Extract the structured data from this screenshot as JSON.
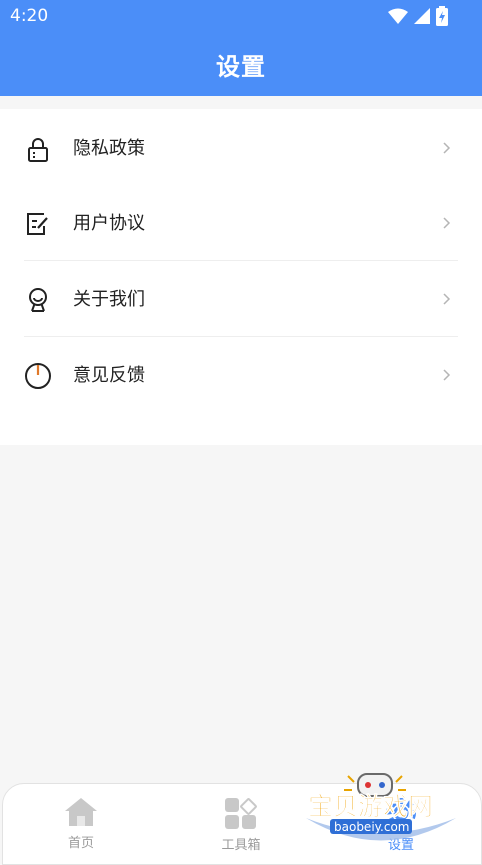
{
  "status_bar": {
    "time": "4:20"
  },
  "header": {
    "title": "设置"
  },
  "menu": {
    "items": [
      {
        "label": "隐私政策",
        "icon": "lock-icon"
      },
      {
        "label": "用户协议",
        "icon": "edit-document-icon"
      },
      {
        "label": "关于我们",
        "icon": "about-person-icon"
      },
      {
        "label": "意见反馈",
        "icon": "power-feedback-icon"
      }
    ]
  },
  "bottom_nav": {
    "items": [
      {
        "label": "首页",
        "icon": "home-icon"
      },
      {
        "label": "工具箱",
        "icon": "toolbox-icon"
      },
      {
        "label": "设置",
        "icon": "settings-icon"
      }
    ]
  },
  "watermark": {
    "title": "宝贝游戏网",
    "url": "baobeiy.com"
  },
  "colors": {
    "accent": "#4b8ef8",
    "text": "#222222",
    "nav_inactive": "#9b9b9b",
    "background": "#f6f6f6"
  }
}
